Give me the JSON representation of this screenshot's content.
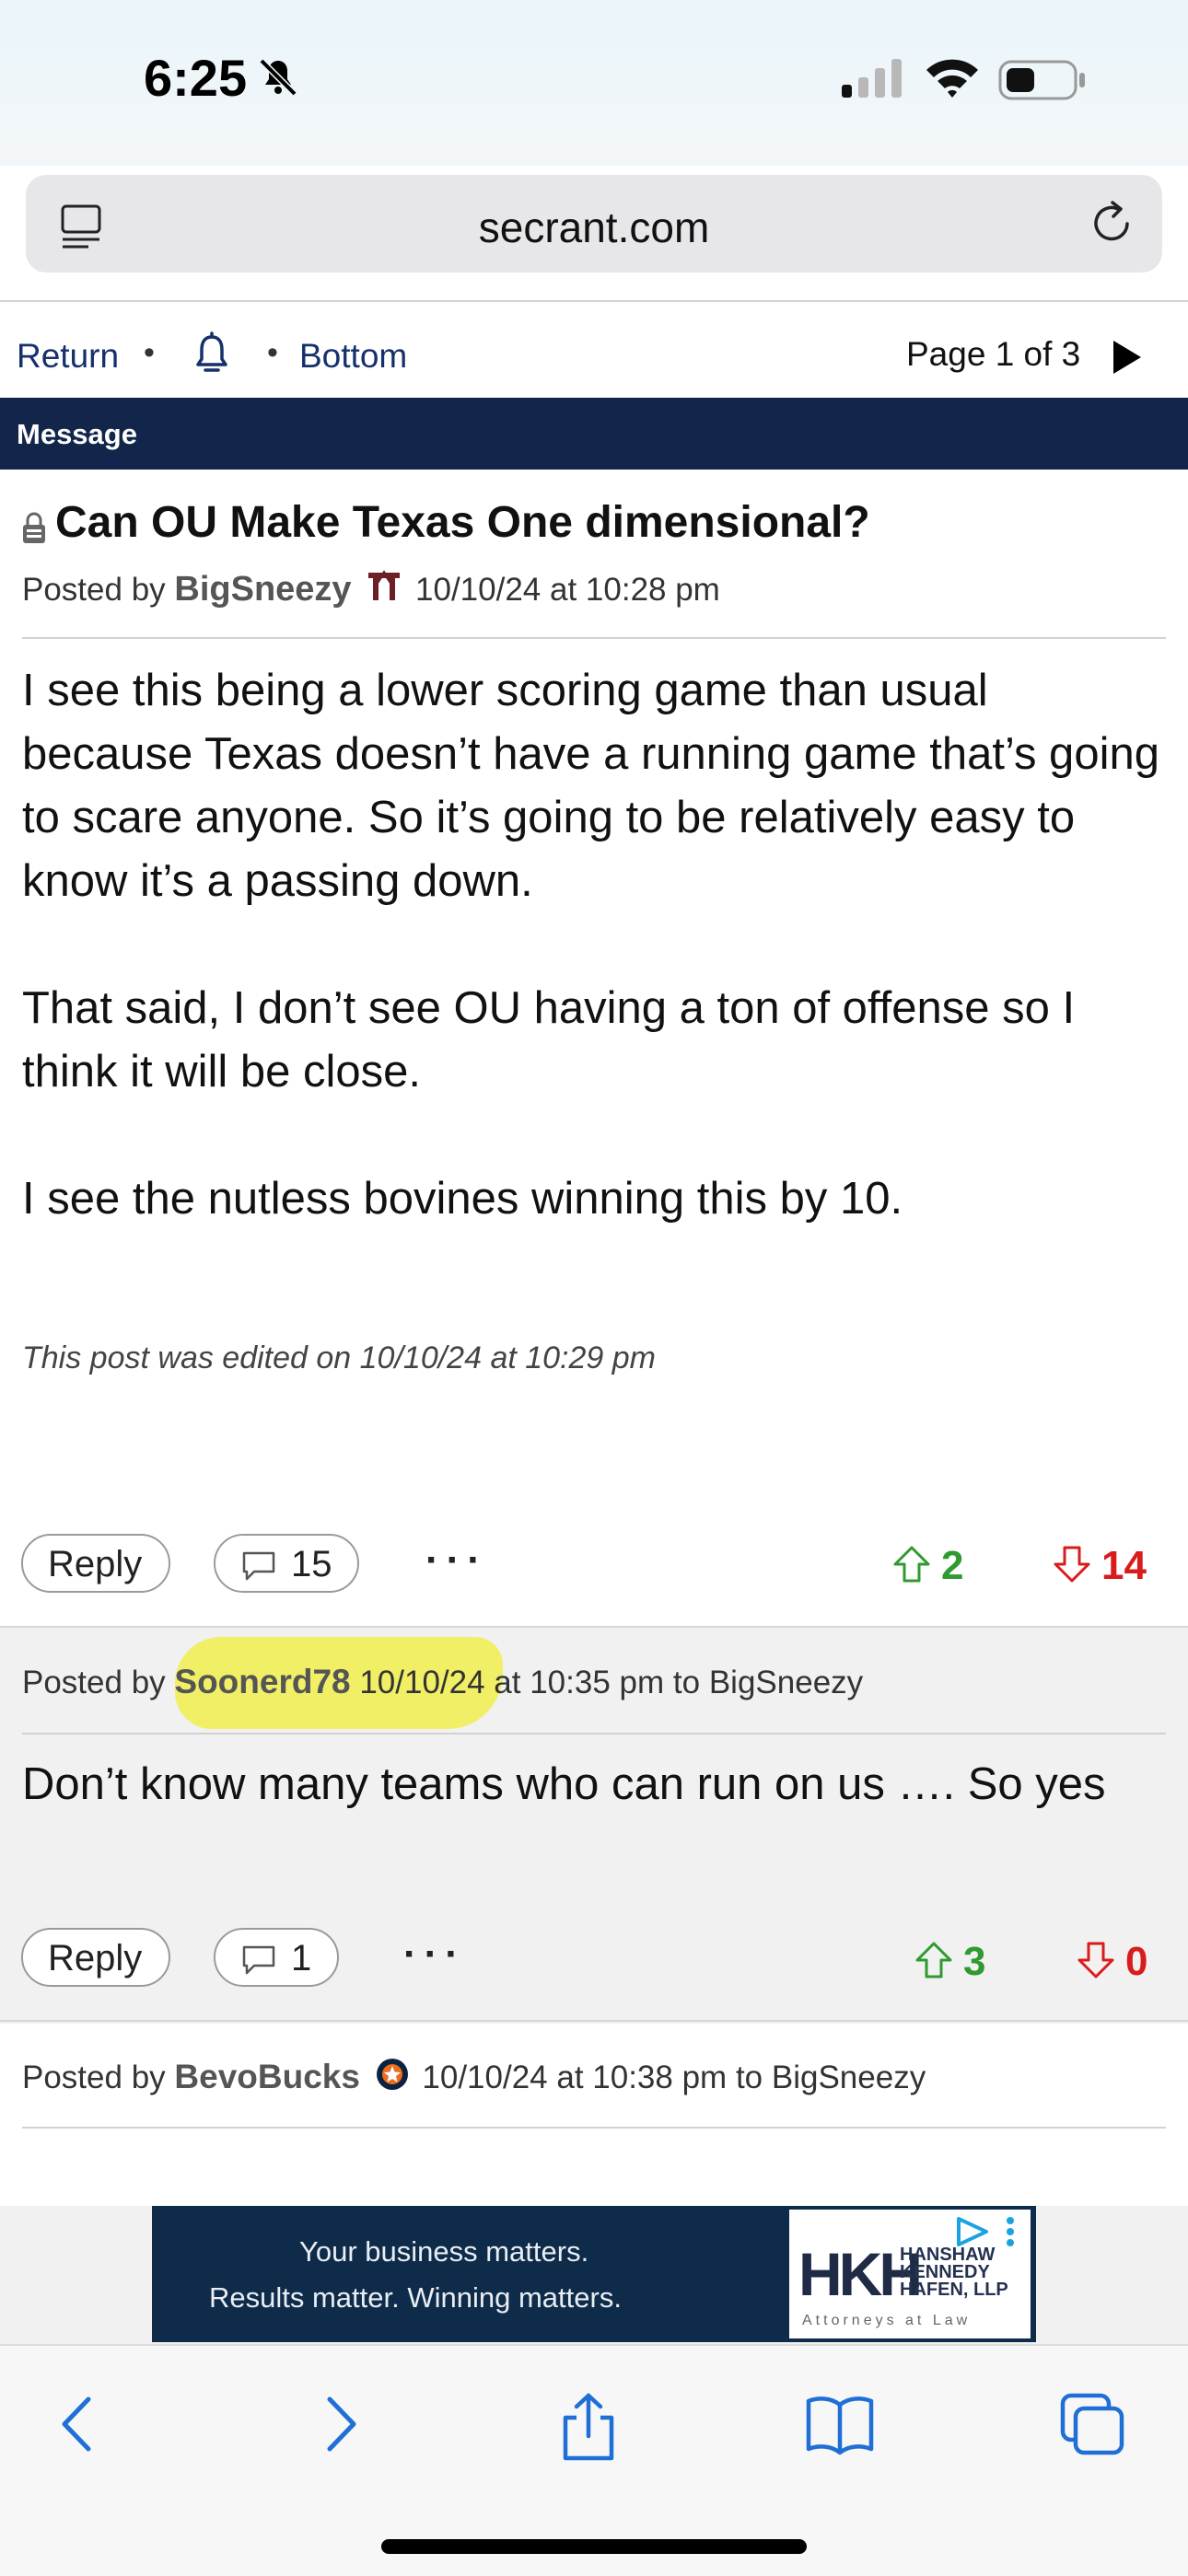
{
  "status_bar": {
    "time": "6:25"
  },
  "browser": {
    "url": "secrant.com"
  },
  "nav": {
    "return": "Return",
    "bottom": "Bottom",
    "page_info": "Page 1 of 3"
  },
  "header": {
    "label": "Message"
  },
  "post": {
    "title": "Can OU Make Texas One dimensional?",
    "posted_by": "Posted by",
    "author": "BigSneezy",
    "timestamp": "10/10/24 at 10:28 pm",
    "paragraphs": [
      "I see this being a lower scoring game than usual because Texas doesn’t have a running game that’s going to scare anyone. So it’s going to be relatively easy to know it’s a passing down.",
      "That said, I don’t see OU having a ton of offense so I think it will be close.",
      "I see the nutless bovines winning this by 10."
    ],
    "edited_note": "This post was edited on 10/10/24 at 10:29 pm",
    "reply_label": "Reply",
    "reply_count": "15",
    "more": "···",
    "upvotes": "2",
    "downvotes": "14"
  },
  "replies": [
    {
      "posted_by": "Posted by",
      "author": "Soonerd78",
      "timestamp": "10/10/24 at 10:35 pm",
      "to_label": "to",
      "to": "BigSneezy",
      "text": "Don’t know many teams who can run on us …. So yes",
      "reply_label": "Reply",
      "reply_count": "1",
      "more": "···",
      "upvotes": "3",
      "downvotes": "0"
    },
    {
      "posted_by": "Posted by",
      "author": "BevoBucks",
      "timestamp": "10/10/24 at 10:38 pm",
      "to_label": "to",
      "to": "BigSneezy"
    }
  ],
  "ad": {
    "line1": "Your business matters.",
    "line2": "Results matter.   Winning matters.",
    "logo_mark": "HKH",
    "firm_lines": [
      "HANSHAW",
      "KENNEDY",
      "HAFEN, LLP"
    ],
    "tagline": "Attorneys at Law"
  },
  "colors": {
    "header_bg": "#12254a",
    "link": "#15306a",
    "upvote": "#2f9a2f",
    "downvote": "#d91c1c",
    "highlight": "#f1ef4e",
    "ad_bg": "#0f2b4a"
  }
}
